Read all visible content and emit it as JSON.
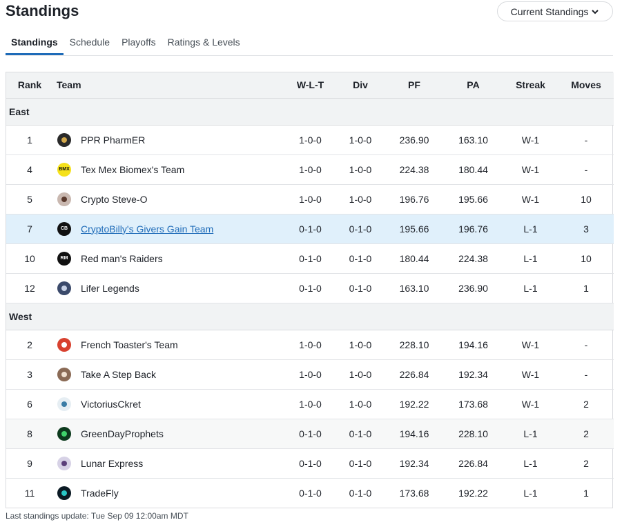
{
  "header": {
    "title": "Standings",
    "dropdown_label": "Current Standings"
  },
  "tabs": [
    {
      "label": "Standings",
      "active": true
    },
    {
      "label": "Schedule",
      "active": false
    },
    {
      "label": "Playoffs",
      "active": false
    },
    {
      "label": "Ratings & Levels",
      "active": false
    }
  ],
  "columns": {
    "rank": "Rank",
    "team": "Team",
    "wlt": "W-L-T",
    "div": "Div",
    "pf": "PF",
    "pa": "PA",
    "streak": "Streak",
    "moves": "Moves"
  },
  "groups": [
    {
      "name": "East",
      "teams": [
        {
          "rank": "1",
          "name": "PPR PharmER",
          "wlt": "1-0-0",
          "div": "1-0-0",
          "pf": "236.90",
          "pa": "163.10",
          "streak": "W-1",
          "moves": "-",
          "logo_bg": "#2a2a2a",
          "logo_fg": "#d4a94b",
          "logo_icon": "pharmacy-icon",
          "logo_text": "",
          "highlight": false,
          "shade": false,
          "link": false
        },
        {
          "rank": "4",
          "name": "Tex Mex Biomex's Team",
          "wlt": "1-0-0",
          "div": "1-0-0",
          "pf": "224.38",
          "pa": "180.44",
          "streak": "W-1",
          "moves": "-",
          "logo_bg": "#f5e11b",
          "logo_fg": "#111111",
          "logo_icon": "bmx-icon",
          "logo_text": "BMX",
          "highlight": false,
          "shade": false,
          "link": false
        },
        {
          "rank": "5",
          "name": "Crypto Steve-O",
          "wlt": "1-0-0",
          "div": "1-0-0",
          "pf": "196.76",
          "pa": "195.66",
          "streak": "W-1",
          "moves": "10",
          "logo_bg": "#c9b8b0",
          "logo_fg": "#5a3a2e",
          "logo_icon": "avatar-icon",
          "logo_text": "",
          "highlight": false,
          "shade": false,
          "link": false
        },
        {
          "rank": "7",
          "name": "CryptoBilly's Givers Gain Team",
          "wlt": "0-1-0",
          "div": "0-1-0",
          "pf": "195.66",
          "pa": "196.76",
          "streak": "L-1",
          "moves": "3",
          "logo_bg": "#111111",
          "logo_fg": "#ffffff",
          "logo_icon": "cb-icon",
          "logo_text": "CB",
          "highlight": true,
          "shade": false,
          "link": true
        },
        {
          "rank": "10",
          "name": "Red man's Raiders",
          "wlt": "0-1-0",
          "div": "0-1-0",
          "pf": "180.44",
          "pa": "224.38",
          "streak": "L-1",
          "moves": "10",
          "logo_bg": "#111111",
          "logo_fg": "#ffffff",
          "logo_icon": "rm-icon",
          "logo_text": "RM",
          "highlight": false,
          "shade": false,
          "link": false
        },
        {
          "rank": "12",
          "name": "Lifer Legends",
          "wlt": "0-1-0",
          "div": "0-1-0",
          "pf": "163.10",
          "pa": "236.90",
          "streak": "L-1",
          "moves": "1",
          "logo_bg": "#3b4a6b",
          "logo_fg": "#c8d2e6",
          "logo_icon": "player-icon",
          "logo_text": "",
          "highlight": false,
          "shade": false,
          "link": false
        }
      ]
    },
    {
      "name": "West",
      "teams": [
        {
          "rank": "2",
          "name": "French Toaster's Team",
          "wlt": "1-0-0",
          "div": "1-0-0",
          "pf": "228.10",
          "pa": "194.16",
          "streak": "W-1",
          "moves": "-",
          "logo_bg": "#d8412f",
          "logo_fg": "#ffffff",
          "logo_icon": "toaster-icon",
          "logo_text": "",
          "highlight": false,
          "shade": false,
          "link": false
        },
        {
          "rank": "3",
          "name": "Take A Step Back",
          "wlt": "1-0-0",
          "div": "1-0-0",
          "pf": "226.84",
          "pa": "192.34",
          "streak": "W-1",
          "moves": "-",
          "logo_bg": "#8a6a55",
          "logo_fg": "#f0e0d0",
          "logo_icon": "person-icon",
          "logo_text": "",
          "highlight": false,
          "shade": false,
          "link": false
        },
        {
          "rank": "6",
          "name": "VictoriusCkret",
          "wlt": "1-0-0",
          "div": "1-0-0",
          "pf": "192.22",
          "pa": "173.68",
          "streak": "W-1",
          "moves": "2",
          "logo_bg": "#e6eef3",
          "logo_fg": "#3a7ca5",
          "logo_icon": "cricket-icon",
          "logo_text": "",
          "highlight": false,
          "shade": false,
          "link": false
        },
        {
          "rank": "8",
          "name": "GreenDayProphets",
          "wlt": "0-1-0",
          "div": "0-1-0",
          "pf": "194.16",
          "pa": "228.10",
          "streak": "L-1",
          "moves": "2",
          "logo_bg": "#0d3b1e",
          "logo_fg": "#3fd46b",
          "logo_icon": "wave-icon",
          "logo_text": "",
          "highlight": false,
          "shade": true,
          "link": false
        },
        {
          "rank": "9",
          "name": "Lunar Express",
          "wlt": "0-1-0",
          "div": "0-1-0",
          "pf": "192.34",
          "pa": "226.84",
          "streak": "L-1",
          "moves": "2",
          "logo_bg": "#d7d2e6",
          "logo_fg": "#5b3f7a",
          "logo_icon": "astronaut-icon",
          "logo_text": "",
          "highlight": false,
          "shade": false,
          "link": false
        },
        {
          "rank": "11",
          "name": "TradeFly",
          "wlt": "0-1-0",
          "div": "0-1-0",
          "pf": "173.68",
          "pa": "192.22",
          "streak": "L-1",
          "moves": "1",
          "logo_bg": "#0b1a24",
          "logo_fg": "#28c6c6",
          "logo_icon": "tf-icon",
          "logo_text": "",
          "highlight": false,
          "shade": false,
          "link": false
        }
      ]
    }
  ],
  "footer": "Last standings update: Tue Sep 09 12:00am MDT"
}
